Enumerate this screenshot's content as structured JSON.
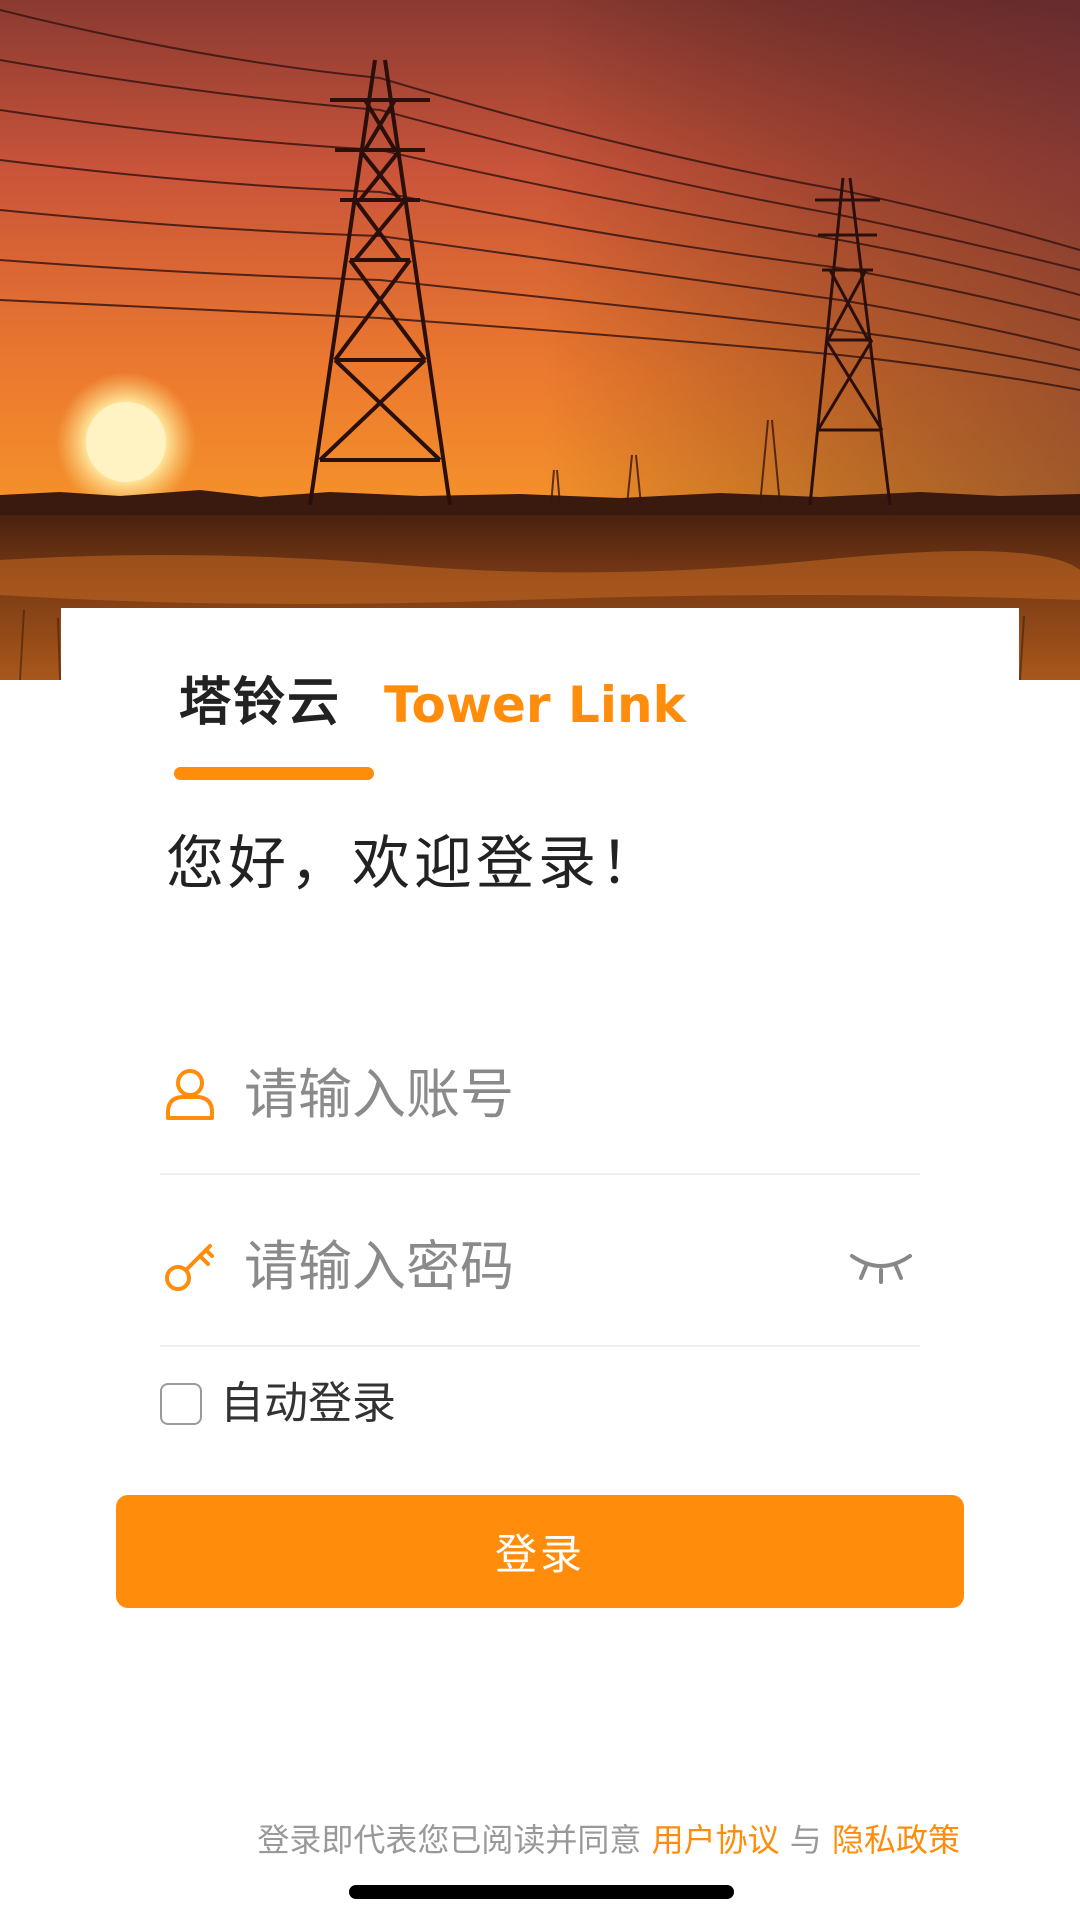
{
  "brand": {
    "name_cn": "塔铃云",
    "name_en": "Tower Link"
  },
  "greeting": "您好，欢迎登录！",
  "account": {
    "placeholder": "请输入账号",
    "value": "",
    "icon": "user-icon"
  },
  "password": {
    "placeholder": "请输入密码",
    "value": "",
    "icon": "key-icon",
    "toggle_icon": "eye-closed-icon"
  },
  "auto_login": {
    "label": "自动登录",
    "checked": false
  },
  "login_button": {
    "label": "登录"
  },
  "agreement": {
    "prefix": "登录即代表您已阅读并同意",
    "user_agreement": "用户协议",
    "conjunction": "与",
    "privacy_policy": "隐私政策"
  },
  "colors": {
    "accent": "#FF8C0A",
    "text_primary": "#222222",
    "text_placeholder": "#8a8a8a",
    "text_muted": "#999999"
  }
}
